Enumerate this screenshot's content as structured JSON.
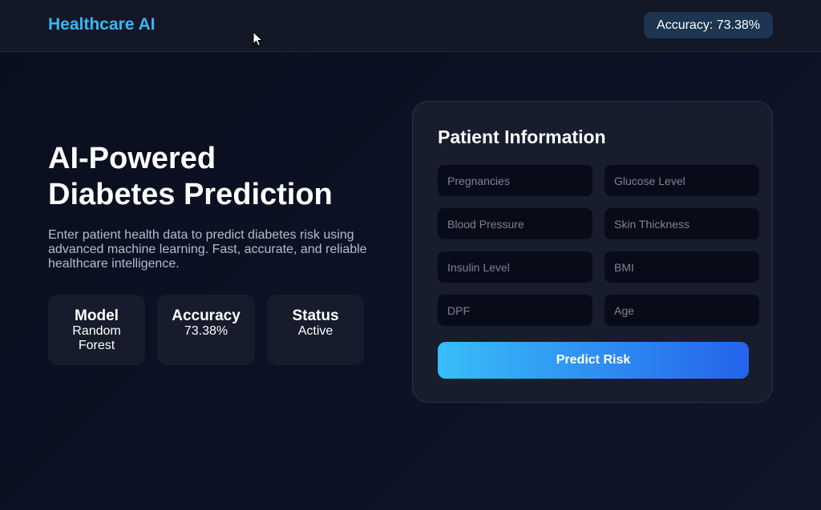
{
  "nav": {
    "brand": "Healthcare AI",
    "accuracy_badge": "Accuracy: 73.38%"
  },
  "hero": {
    "title": "AI-Powered\nDiabetes Prediction",
    "description": "Enter patient health data to predict diabetes risk using advanced machine learning. Fast, accurate, and reliable healthcare intelligence."
  },
  "stats": [
    {
      "label": "Model",
      "value": "Random Forest"
    },
    {
      "label": "Accuracy",
      "value": "73.38%"
    },
    {
      "label": "Status",
      "value": "Active"
    }
  ],
  "form": {
    "title": "Patient Information",
    "fields": [
      {
        "placeholder": "Pregnancies",
        "value": ""
      },
      {
        "placeholder": "Glucose Level",
        "value": ""
      },
      {
        "placeholder": "Blood Pressure",
        "value": ""
      },
      {
        "placeholder": "Skin Thickness",
        "value": ""
      },
      {
        "placeholder": "Insulin Level",
        "value": ""
      },
      {
        "placeholder": "BMI",
        "value": ""
      },
      {
        "placeholder": "DPF",
        "value": ""
      },
      {
        "placeholder": "Age",
        "value": ""
      }
    ],
    "submit_label": "Predict Risk"
  },
  "colors": {
    "brand": "#38b6f5",
    "badge_bg": "#1c3550",
    "button_start": "#38bdf8",
    "button_end": "#2563eb"
  },
  "icons": {
    "cursor": "mouse-pointer-icon"
  }
}
